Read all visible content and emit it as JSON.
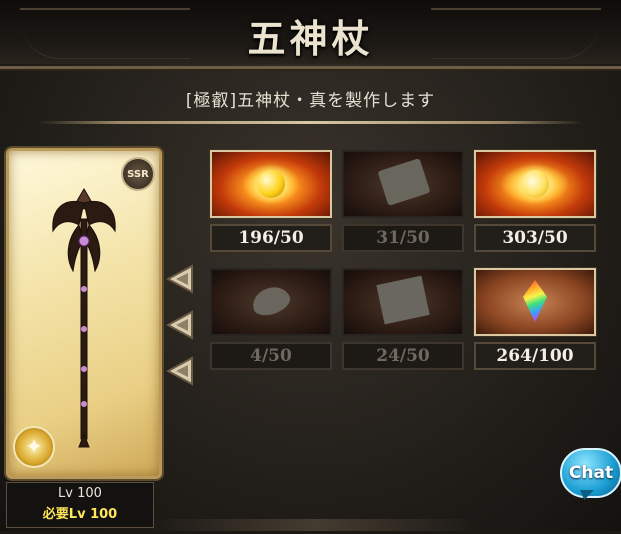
{
  "header": {
    "title": "五神杖"
  },
  "recipe": {
    "subtitle": "[極叡]五神杖・真を製作します"
  },
  "weapon_card": {
    "rarity": "SSR",
    "element_icon": "light-element-icon",
    "level_label": "Lv 100",
    "required_level_label": "必要Lv 100"
  },
  "materials": [
    {
      "icon": "golden-orb-icon",
      "count": "196/50",
      "status": "sufficient"
    },
    {
      "icon": "scroll-icon",
      "count": "31/50",
      "status": "insufficient"
    },
    {
      "icon": "golden-flame-crown-icon",
      "count": "303/50",
      "status": "sufficient"
    },
    {
      "icon": "feather-icon",
      "count": "4/50",
      "status": "insufficient"
    },
    {
      "icon": "sealed-letter-icon",
      "count": "24/50",
      "status": "insufficient"
    },
    {
      "icon": "rainbow-crystal-icon",
      "count": "264/100",
      "status": "sufficient"
    }
  ],
  "chat": {
    "label": "Chat"
  },
  "colors": {
    "active_count": "#f3efe6",
    "inactive_count": "#6e685f",
    "required_level": "#ffe55c",
    "chat_button": "#1a9ed3"
  }
}
